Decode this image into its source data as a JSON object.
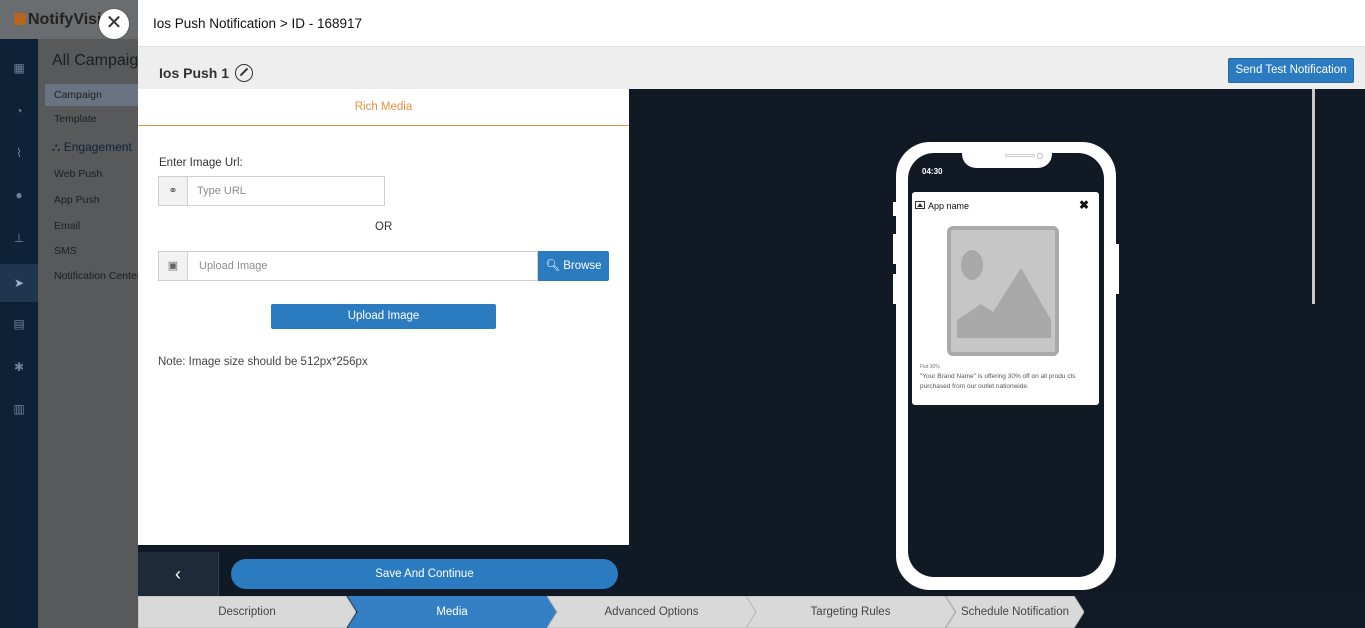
{
  "app": {
    "logo": "NotifyVisi",
    "section_title": "All Campaign",
    "nav": {
      "campaign": "Campaign",
      "template": "Template",
      "engagement": "Engagement",
      "web_push": "Web Push",
      "app_push": "App Push",
      "email": "Email",
      "sms": "SMS",
      "notification_center": "Notification Center"
    }
  },
  "modal": {
    "title": "Ios Push Notification > ID - 168917",
    "close_label": "✕",
    "campaign_name": "Ios Push 1",
    "send_test_label": "Send Test Notification"
  },
  "media_panel": {
    "tab_label": "Rich Media",
    "url_label": "Enter Image Url:",
    "url_placeholder": "Type URL",
    "url_value": "",
    "or_text": "OR",
    "upload_placeholder": "Upload Image",
    "browse_label": "Browse",
    "upload_button_label": "Upload Image",
    "note": "Note: Image size should be 512px*256px"
  },
  "footer": {
    "back_label": "‹",
    "save_label": "Save And Continue"
  },
  "preview": {
    "time": "04:30",
    "app_name": "App name",
    "close_glyph": "✖",
    "small_text": "Flat 30%",
    "body_text": "\"Your Brand Name\" is offering 30% off on all produ cts purchased from our outlet nationwide."
  },
  "steps": [
    {
      "label": "Description",
      "active": false
    },
    {
      "label": "Media",
      "active": true
    },
    {
      "label": "Advanced Options",
      "active": false
    },
    {
      "label": "Targeting Rules",
      "active": false
    },
    {
      "label": "Schedule Notification",
      "active": false
    }
  ],
  "colors": {
    "accent": "#2b7bc0",
    "tab_active": "#e8923f",
    "preview_bg": "#111a24",
    "step_active": "#3580c4",
    "step_inactive": "#d9d9d9"
  }
}
